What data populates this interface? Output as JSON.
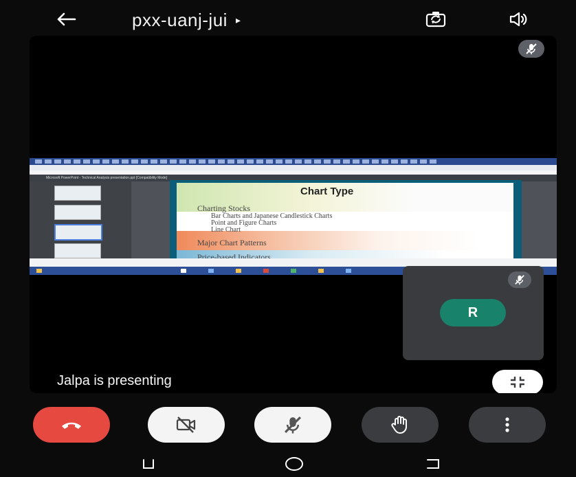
{
  "header": {
    "meeting_code": "pxx-uanj-jui",
    "caret": "▸"
  },
  "stage": {
    "presenter_text": "Jalpa is presenting",
    "shared_window": {
      "app_title": "Microsoft PowerPoint - Technical Analysis presentation.ppt [Compatibility Mode]",
      "slide_title": "Chart Type",
      "bullets": [
        "Charting Stocks",
        "Bar Charts and Japanese Candlestick Charts",
        "Point and Figure Charts",
        "Line Chart",
        "Major Chart Patterns",
        "Price-based Indicators"
      ]
    }
  },
  "self_tile": {
    "avatar_initial": "R",
    "avatar_color": "#19826b"
  },
  "controls": {
    "end_call_color": "#e64940",
    "active_color": "#f4f4f4",
    "inactive_color": "#3b3c40"
  },
  "icons": {
    "back": "arrow-left-icon",
    "switch_camera": "switch-camera-icon",
    "speaker": "speaker-icon",
    "mic_off": "mic-off-icon",
    "camera_off": "camera-off-icon",
    "raise_hand": "hand-icon",
    "more": "more-vert-icon",
    "minimize": "minimize-icon",
    "end_call": "phone-hangup-icon"
  }
}
